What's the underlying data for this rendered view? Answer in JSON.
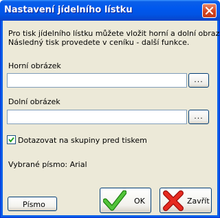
{
  "window": {
    "title": "Nastavení jídelního lístku"
  },
  "description": {
    "line1": "Pro tisk jídelního lístku můžete vložit horní a dolní obrazek.",
    "line2": "Následný tisk provedete v ceníku - další funkce."
  },
  "top_image": {
    "label": "Horní obrázek",
    "value": "",
    "browse_label": "..."
  },
  "bottom_image": {
    "label": "Dolní obrázek",
    "value": "",
    "browse_label": "..."
  },
  "ask_groups": {
    "label": "Dotazovat na skupiny pred tiskem",
    "checked": true
  },
  "font_info": "Vybrané písmo: Arial",
  "buttons": {
    "font": "Písmo",
    "ok": "OK",
    "close": "Zavřít"
  },
  "colors": {
    "titlebar": "#0058ee",
    "dialog_bg": "#ece9d8",
    "ok_icon": "#3fae2a",
    "close_icon": "#e0201b"
  },
  "icons": {
    "ok": "check-icon",
    "close": "x-icon"
  }
}
